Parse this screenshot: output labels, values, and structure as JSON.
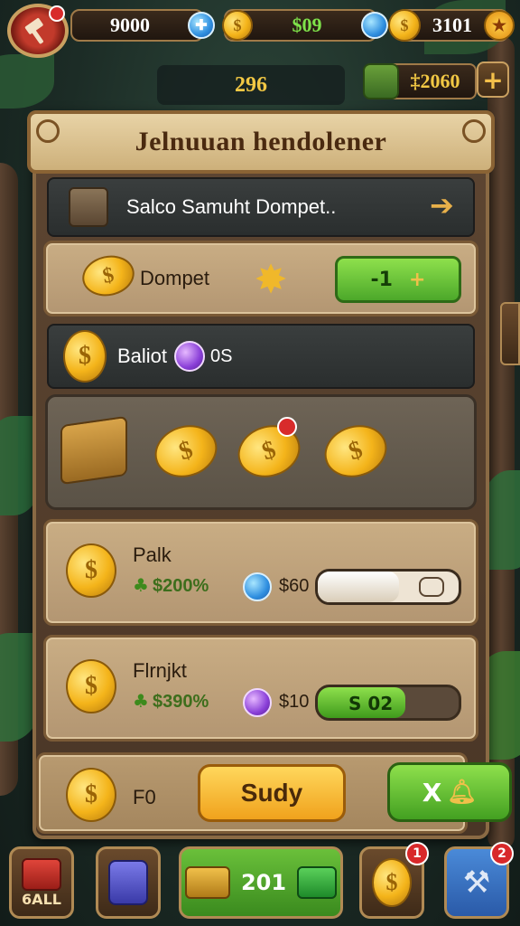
{
  "topbar": {
    "resource_1": "9000",
    "resource_2": "$09",
    "resource_3": "3101"
  },
  "subbar": {
    "left_value": "296",
    "right_value": "‡2060",
    "plus": "+"
  },
  "panel": {
    "title": "Jelnuuan hendolener",
    "header_row_text": "Salco Samuht Dompet..",
    "dompet_row": {
      "label": "Dompet",
      "button_value": "-1",
      "button_icon": "+"
    },
    "balance_row": {
      "label": "Baliot",
      "value": "0S"
    },
    "items": [
      {
        "name": "Palk",
        "percent": "$200%",
        "cost": "$60",
        "progress": 0.58,
        "bar_text": ""
      },
      {
        "name": "Flrnjkt",
        "percent": "$390%",
        "cost": "$10",
        "progress": 0.62,
        "bar_text": "S 02"
      }
    ],
    "footer": {
      "value": "F0",
      "primary_button": "Sudy",
      "secondary_button": "X"
    }
  },
  "bottom_nav": {
    "items": [
      {
        "label": "6ALL",
        "badge": ""
      },
      {
        "label": "",
        "badge": ""
      },
      {
        "label": "201",
        "badge": ""
      },
      {
        "label": "",
        "badge": "1"
      },
      {
        "label": "",
        "badge": "2"
      }
    ]
  },
  "colors": {
    "accent_green": "#4ca82a",
    "accent_yellow": "#f0a21c",
    "wood": "#c9ad84",
    "badge_red": "#d8282a"
  },
  "icons": [
    "hammer-icon",
    "blue-gem-icon",
    "coin-icon",
    "purple-gem-icon",
    "chest-icon",
    "cash-stack-icon",
    "backpack-icon",
    "hammer-tool-icon"
  ]
}
